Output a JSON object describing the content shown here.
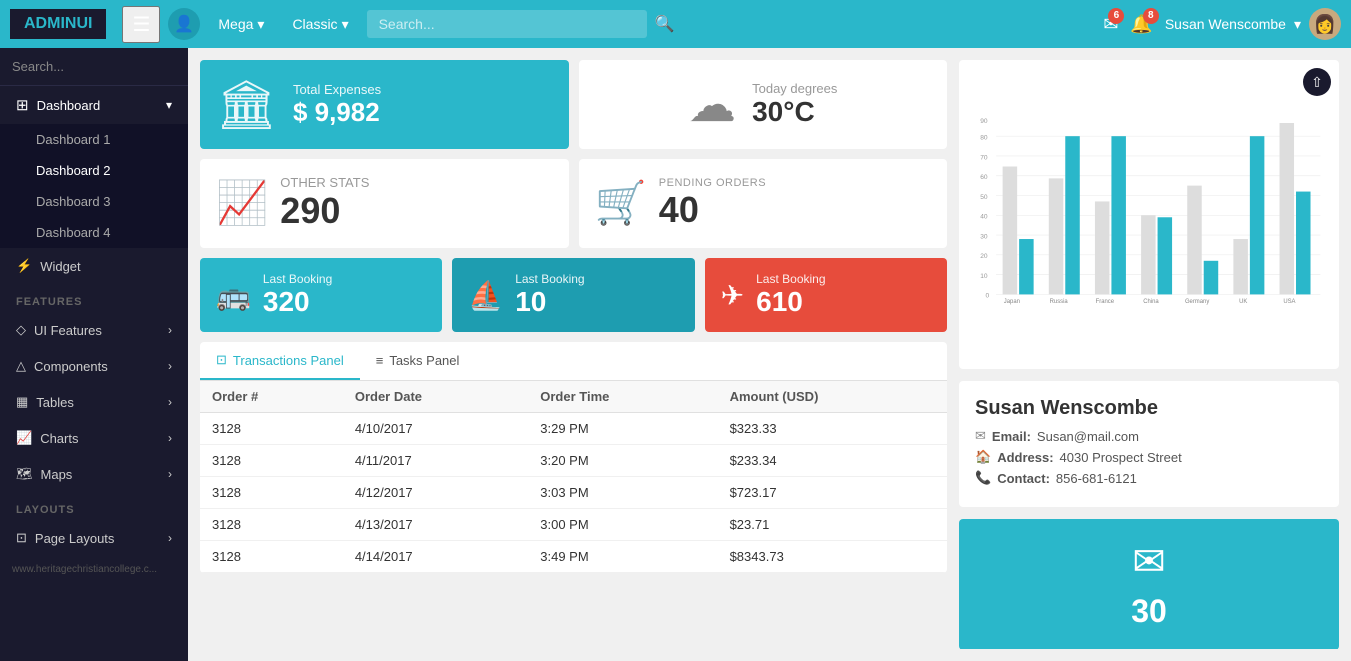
{
  "logo": {
    "text_plain": "ADMIN",
    "text_colored": "UI"
  },
  "topnav": {
    "menu_label": "Mega",
    "menu2_label": "Classic",
    "search_placeholder": "Search...",
    "notif_email_count": "6",
    "notif_bell_count": "8",
    "user_name": "Susan Wenscombe",
    "user_chevron": "▾"
  },
  "sidebar": {
    "search_placeholder": "Search...",
    "items": [
      {
        "label": "Dashboard",
        "icon": "⊞",
        "active": true,
        "has_chevron": true
      },
      {
        "label": "Dashboard 1",
        "sub": true
      },
      {
        "label": "Dashboard 2",
        "sub": true
      },
      {
        "label": "Dashboard 3",
        "sub": true
      },
      {
        "label": "Dashboard 4",
        "sub": true
      },
      {
        "label": "Widget",
        "icon": "⚡",
        "active": false,
        "has_chevron": false
      },
      {
        "section": "FEATURES"
      },
      {
        "label": "UI Features",
        "icon": "◇",
        "active": false,
        "has_chevron": true
      },
      {
        "label": "Components",
        "icon": "△",
        "active": false,
        "has_chevron": true
      },
      {
        "label": "Tables",
        "icon": "▦",
        "active": false,
        "has_chevron": true
      },
      {
        "label": "Charts",
        "icon": "📈",
        "active": false,
        "has_chevron": true
      },
      {
        "label": "Maps",
        "icon": "🗺",
        "active": false,
        "has_chevron": true
      },
      {
        "section": "LAYOUTS"
      },
      {
        "label": "Page Layouts",
        "icon": "⊡",
        "active": false,
        "has_chevron": true
      }
    ]
  },
  "stats": {
    "total_expenses_label": "Total Expenses",
    "total_expenses_value": "$ 9,982",
    "weather_label": "Today degrees",
    "weather_value": "30°C",
    "other_stats_label": "Other Stats",
    "other_stats_value": "290",
    "pending_orders_label": "PENDING ORDERS",
    "pending_orders_value": "40"
  },
  "bookings": [
    {
      "label": "Last Booking",
      "value": "320",
      "icon": "🚌",
      "color": "green"
    },
    {
      "label": "Last Booking",
      "value": "10",
      "icon": "⛵",
      "color": "teal"
    },
    {
      "label": "Last Booking",
      "value": "610",
      "icon": "✈",
      "color": "red"
    }
  ],
  "chart": {
    "countries": [
      "Japan",
      "Russia",
      "France",
      "China",
      "Germany",
      "UK",
      "USA"
    ],
    "series1": [
      62,
      59,
      47,
      40,
      55,
      28,
      90
    ],
    "series2": [
      28,
      80,
      80,
      39,
      17,
      80,
      52
    ],
    "y_max": 90,
    "y_ticks": [
      0,
      10,
      20,
      30,
      40,
      50,
      60,
      70,
      80,
      90
    ],
    "share_icon": "⇧"
  },
  "transactions": {
    "tab1_label": "Transactions Panel",
    "tab2_label": "Tasks Panel",
    "tab1_icon": "⊡",
    "tab2_icon": "≡",
    "columns": [
      "Order #",
      "Order Date",
      "Order Time",
      "Amount (USD)"
    ],
    "rows": [
      [
        "3128",
        "4/10/2017",
        "3:29 PM",
        "$323.33"
      ],
      [
        "3128",
        "4/11/2017",
        "3:20 PM",
        "$233.34"
      ],
      [
        "3128",
        "4/12/2017",
        "3:03 PM",
        "$723.17"
      ],
      [
        "3128",
        "4/13/2017",
        "3:00 PM",
        "$23.71"
      ],
      [
        "3128",
        "4/14/2017",
        "3:49 PM",
        "$8343.73"
      ]
    ]
  },
  "user_card": {
    "name": "Susan Wenscombe",
    "email_label": "Email:",
    "email_value": "Susan@mail.com",
    "address_label": "Address:",
    "address_value": "4030 Prospect Street",
    "contact_label": "Contact:",
    "contact_value": "856-681-6121"
  },
  "mail_panel": {
    "count": "30"
  }
}
